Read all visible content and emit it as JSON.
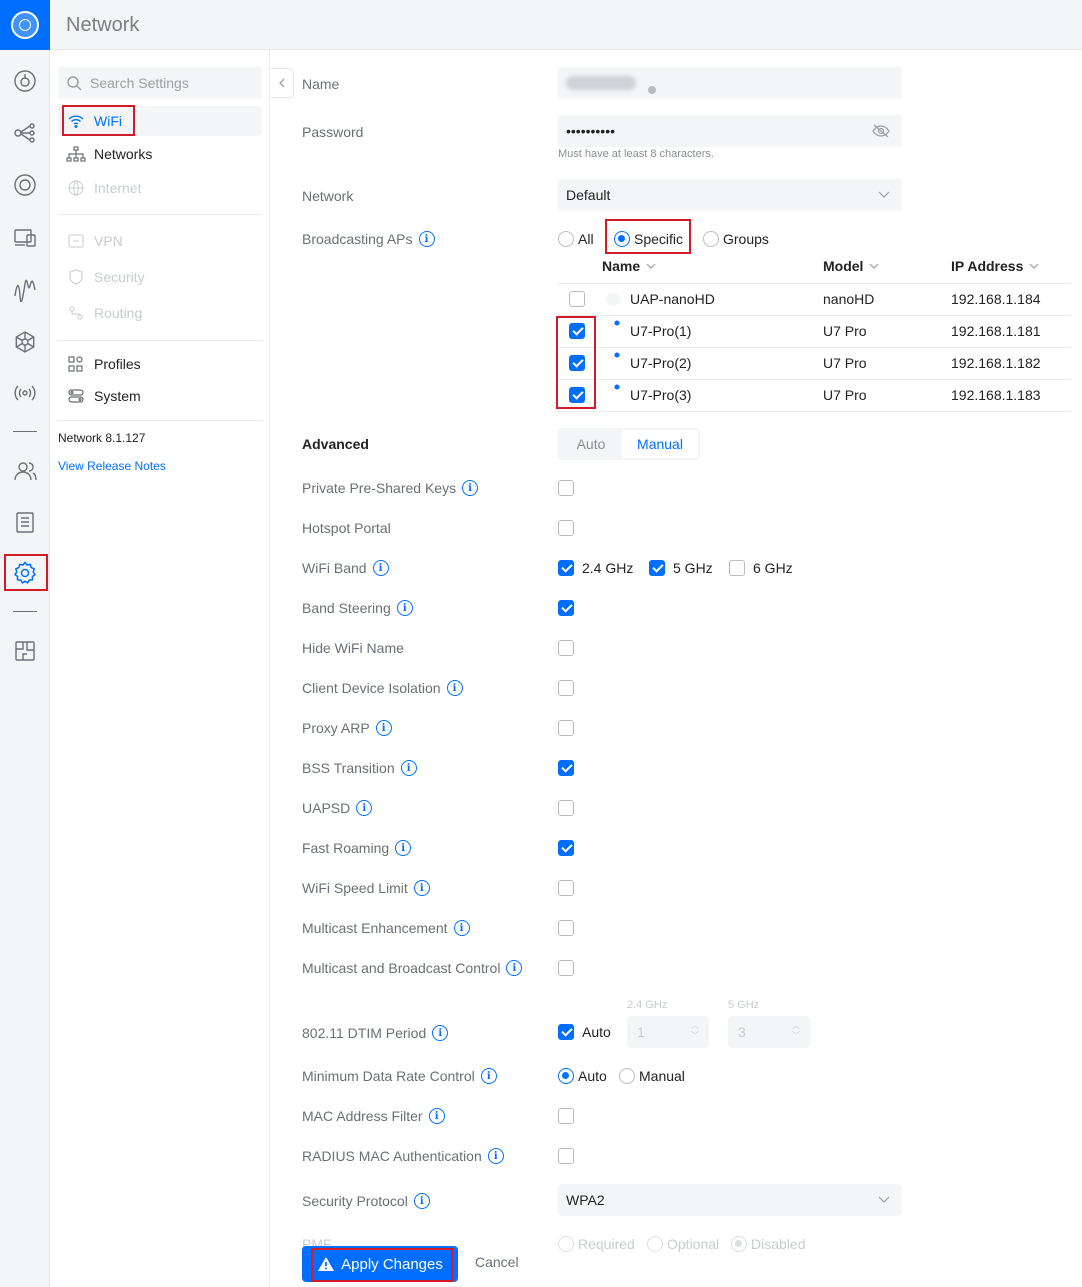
{
  "app": {
    "title": "Network"
  },
  "colors": {
    "accent": "#006fff",
    "highlight": "#d21c2b"
  },
  "rail": {
    "icons": [
      "dashboard-icon",
      "topology-icon",
      "devices-icon",
      "client-devices-icon",
      "statistics-icon",
      "integrations-icon",
      "radio-icon",
      "users-icon",
      "logs-icon",
      "settings-icon",
      "innerspace-icon"
    ]
  },
  "subnav": {
    "search_placeholder": "Search Settings",
    "items": {
      "wifi": "WiFi",
      "networks": "Networks",
      "internet": "Internet",
      "vpn": "VPN",
      "security": "Security",
      "routing": "Routing",
      "profiles": "Profiles",
      "system": "System"
    },
    "version": "Network 8.1.127",
    "release_notes": "View Release Notes"
  },
  "form": {
    "name_label": "Name",
    "password_label": "Password",
    "password_value": "••••••••••",
    "password_help": "Must have at least 8 characters.",
    "network_label": "Network",
    "network_value": "Default",
    "broadcasting_label": "Broadcasting APs",
    "broadcast_options": {
      "all": "All",
      "specific": "Specific",
      "groups": "Groups"
    },
    "broadcast_selected": "Specific",
    "ap_table": {
      "headers": {
        "name": "Name",
        "model": "Model",
        "ip": "IP Address"
      },
      "rows": [
        {
          "name": "UAP-nanoHD",
          "model": "nanoHD",
          "ip": "192.168.1.184",
          "checked": false
        },
        {
          "name": "U7-Pro(1)",
          "model": "U7 Pro",
          "ip": "192.168.1.181",
          "checked": true
        },
        {
          "name": "U7-Pro(2)",
          "model": "U7 Pro",
          "ip": "192.168.1.182",
          "checked": true
        },
        {
          "name": "U7-Pro(3)",
          "model": "U7 Pro",
          "ip": "192.168.1.183",
          "checked": true
        }
      ]
    },
    "advanced_label": "Advanced",
    "advanced_modes": {
      "auto": "Auto",
      "manual": "Manual"
    },
    "advanced_selected": "Manual",
    "options": {
      "ppsk": "Private Pre-Shared Keys",
      "hotspot": "Hotspot Portal",
      "wifi_band": "WiFi Band",
      "band_steering": "Band Steering",
      "hide_name": "Hide WiFi Name",
      "client_isolation": "Client Device Isolation",
      "proxy_arp": "Proxy ARP",
      "bss_transition": "BSS Transition",
      "uapsd": "UAPSD",
      "fast_roaming": "Fast Roaming",
      "speed_limit": "WiFi Speed Limit",
      "multicast_enh": "Multicast Enhancement",
      "multicast_ctrl": "Multicast and Broadcast Control",
      "dtim": "802.11 DTIM Period",
      "min_rate": "Minimum Data Rate Control",
      "mac_filter": "MAC Address Filter",
      "radius_mac": "RADIUS MAC Authentication",
      "security_protocol": "Security Protocol",
      "pmf": "PMF"
    },
    "bands": {
      "b24": "2.4 GHz",
      "b5": "5 GHz",
      "b6": "6 GHz"
    },
    "dtim": {
      "auto": "Auto",
      "label24": "2.4 GHz",
      "label5": "5 GHz",
      "value24": "1",
      "value5": "3"
    },
    "min_rate_opts": {
      "auto": "Auto",
      "manual": "Manual"
    },
    "security_value": "WPA2",
    "pmf_opts": {
      "required": "Required",
      "optional": "Optional",
      "disabled": "Disabled"
    }
  },
  "actions": {
    "apply": "Apply Changes",
    "cancel": "Cancel"
  }
}
